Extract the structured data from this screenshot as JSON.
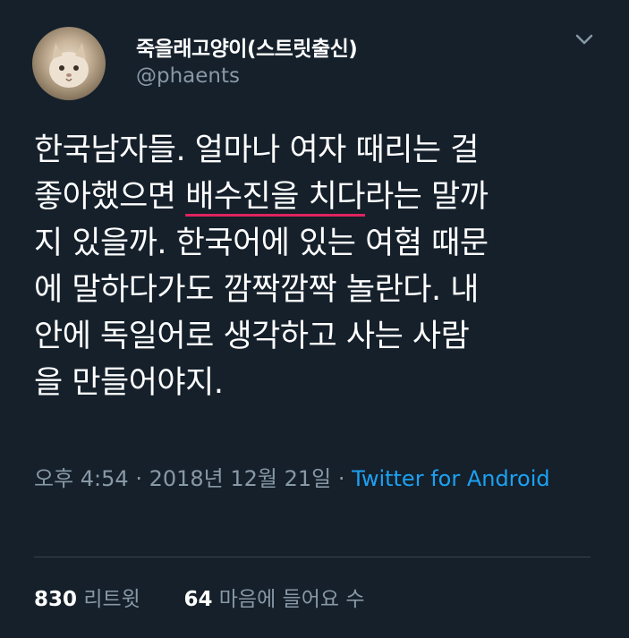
{
  "user": {
    "display_name": "죽을래고양이(스트릿출신)",
    "handle": "@phaents"
  },
  "tweet": {
    "text_pre": "한국남자들. 얼마나 여자 때리는 걸\n좋아했으면 ",
    "text_underlined": "배수진을 치다",
    "text_post": "라는 말까\n지 있을까. 한국어에 있는 여혐 때문\n에 말하다가도 깜짝깜짝 놀란다. 내\n안에 독일어로 생각하고 사는 사람\n을 만들어야지."
  },
  "meta": {
    "time": "오후 4:54",
    "separator1": " · ",
    "date": "2018년 12월 21일",
    "separator2": " · ",
    "source": "Twitter for Android"
  },
  "stats": {
    "retweets_count": "830",
    "retweets_label": "리트윗",
    "likes_count": "64",
    "likes_label": "마음에 들어요 수"
  },
  "icons": {
    "menu": "chevron-down-icon",
    "avatar": "cat-avatar"
  },
  "colors": {
    "background": "#15202b",
    "secondary_text": "#8899a6",
    "link": "#1da1f2",
    "underline": "#e0245e"
  }
}
